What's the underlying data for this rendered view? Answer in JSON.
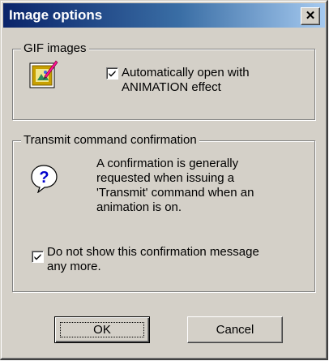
{
  "window": {
    "title": "Image options",
    "close_glyph": "✕"
  },
  "gif_group": {
    "legend": "GIF images",
    "icon": "image-edit-icon",
    "checkbox_checked": true,
    "checkbox_label_line1": "Automatically open with",
    "checkbox_label_line2": "ANIMATION effect"
  },
  "transmit_group": {
    "legend": "Transmit command confirmation",
    "icon": "question-bubble-icon",
    "info_line1": "A confirmation is generally",
    "info_line2": "requested when issuing a",
    "info_line3": "'Transmit' command when an",
    "info_line4": "animation is on.",
    "checkbox_checked": true,
    "checkbox_label_line1": "Do not show this confirmation message",
    "checkbox_label_line2": "any more."
  },
  "buttons": {
    "ok_label": "OK",
    "cancel_label": "Cancel"
  },
  "colors": {
    "title_gradient_start": "#0a246a",
    "title_gradient_end": "#a6caf0",
    "face": "#d4d0c8"
  }
}
